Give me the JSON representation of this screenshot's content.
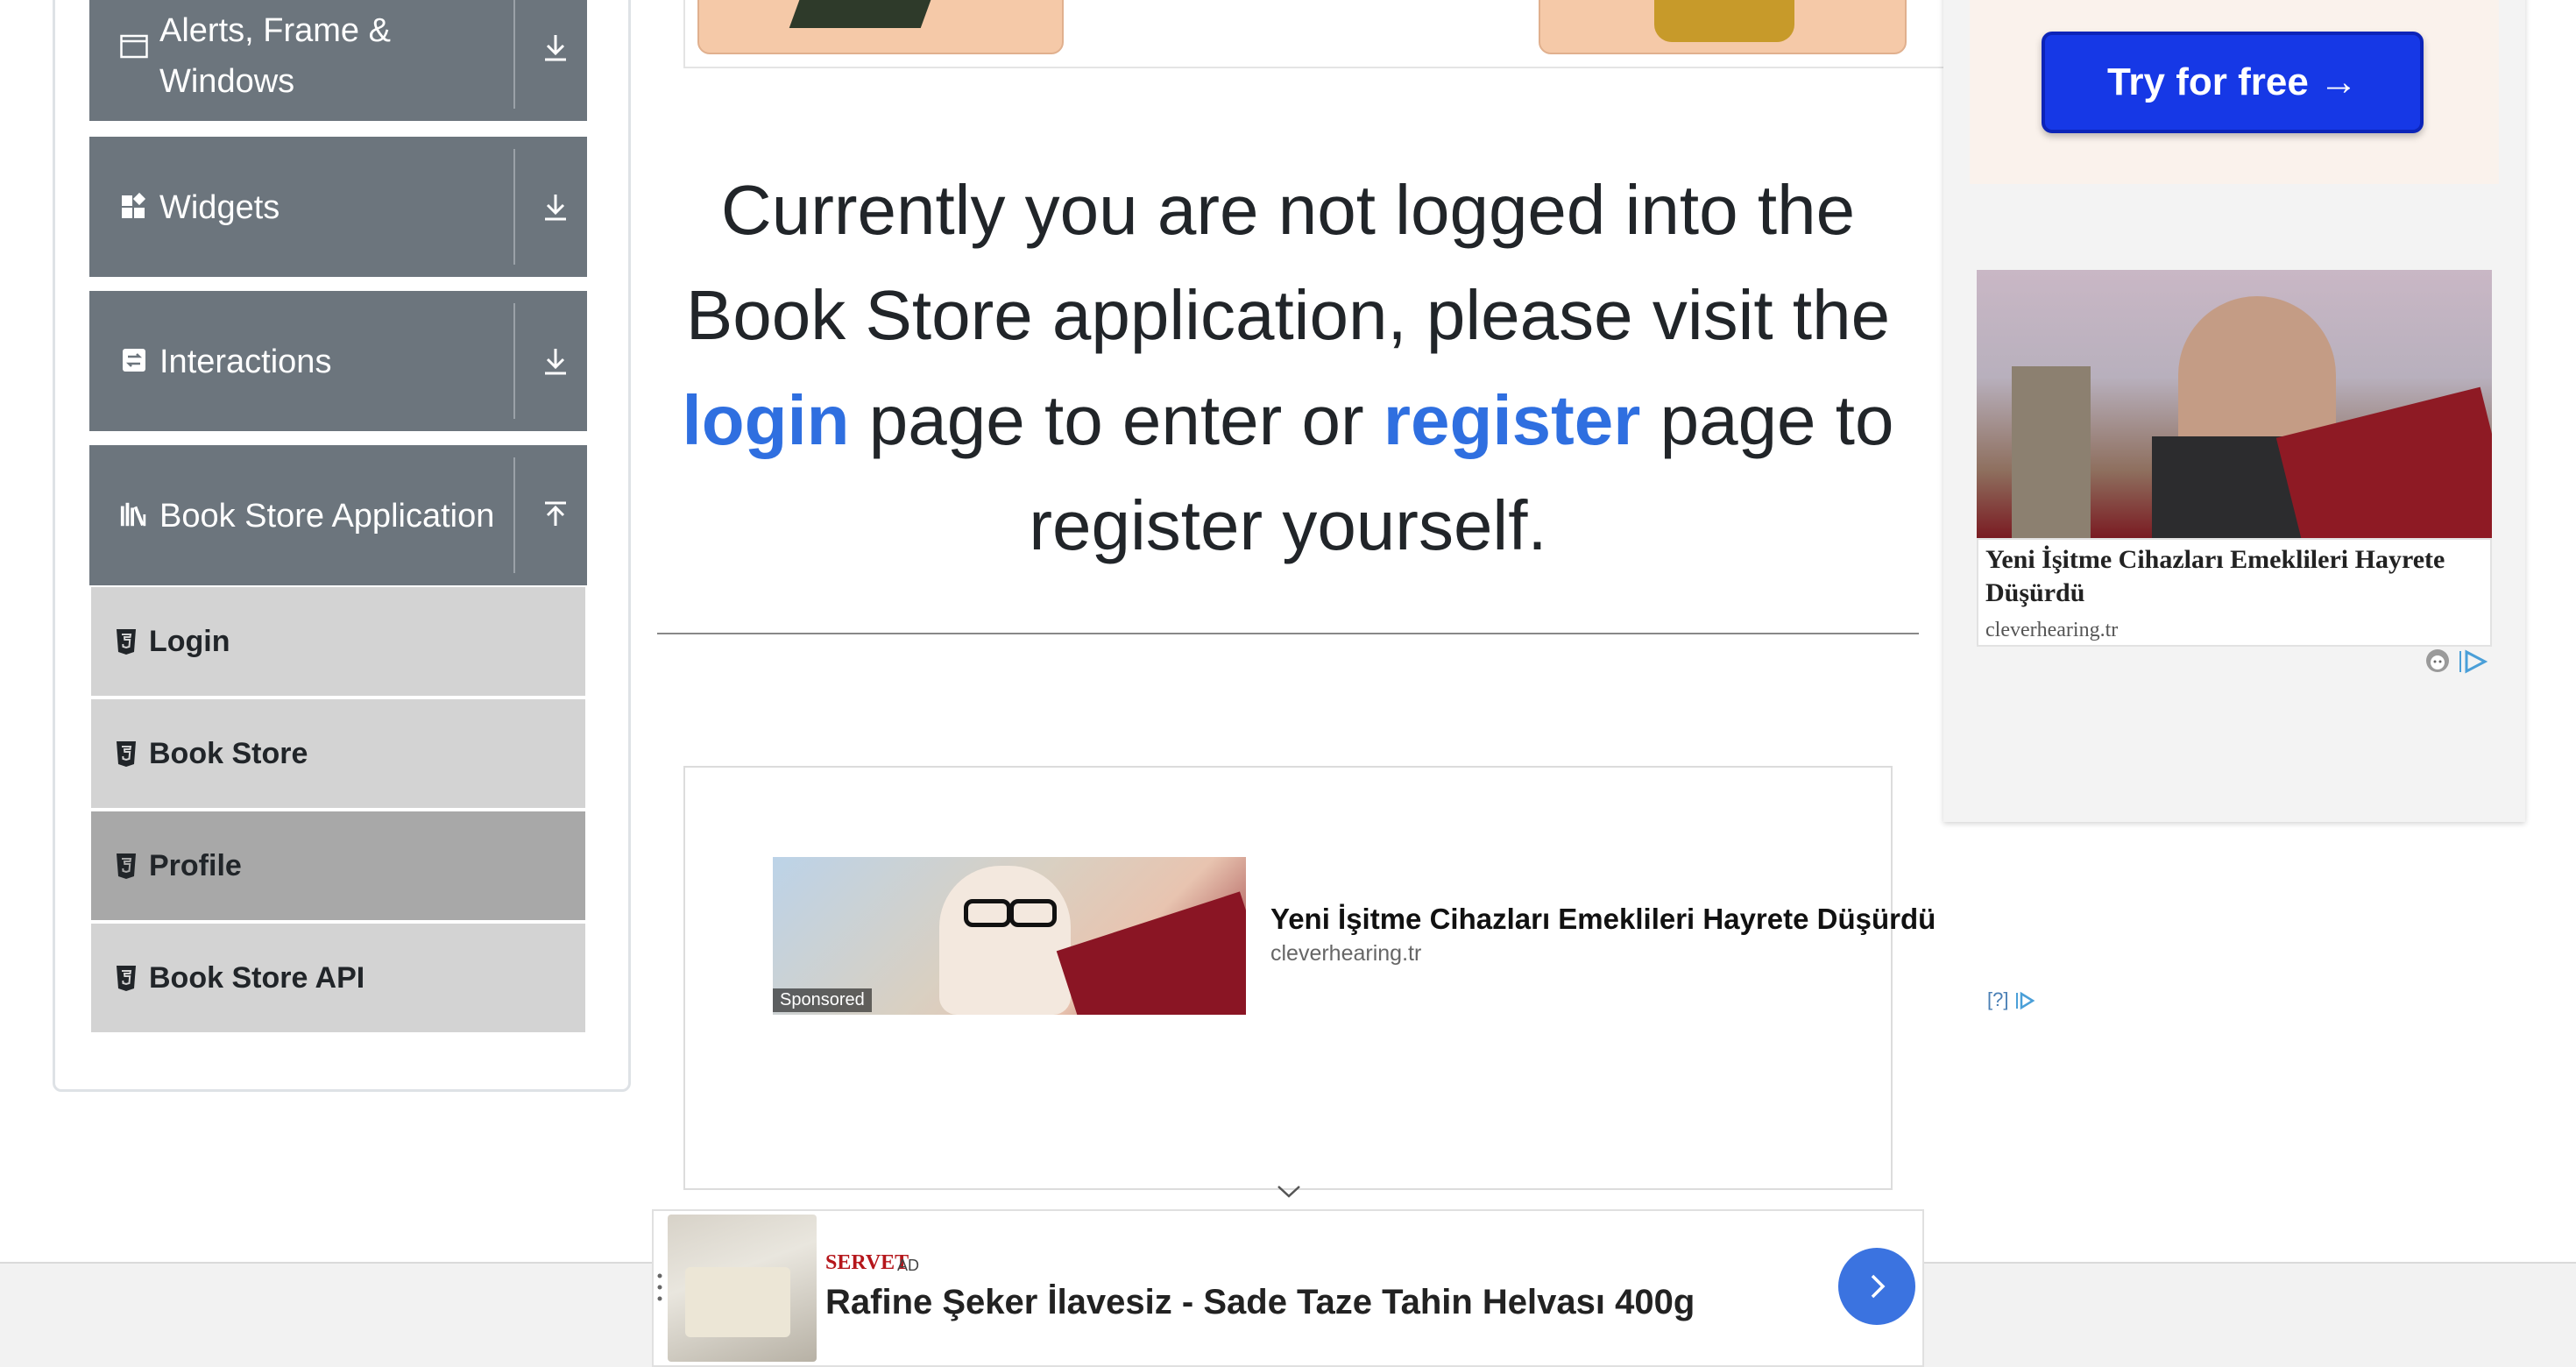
{
  "sidebar": {
    "groups": [
      {
        "label_line1": "Alerts, Frame &",
        "label_line2": "Windows",
        "icon": "window-icon",
        "chevron": "download-arrow-icon"
      },
      {
        "label": "Widgets",
        "icon": "widgets-icon",
        "chevron": "download-arrow-icon"
      },
      {
        "label": "Interactions",
        "icon": "interactions-icon",
        "chevron": "download-arrow-icon"
      },
      {
        "label": "Book Store Application",
        "icon": "books-icon",
        "chevron": "upload-arrow-icon"
      }
    ],
    "items": [
      {
        "label": "Login",
        "icon": "html5-icon",
        "active": false
      },
      {
        "label": "Book Store",
        "icon": "html5-icon",
        "active": false
      },
      {
        "label": "Profile",
        "icon": "html5-icon",
        "active": true
      },
      {
        "label": "Book Store API",
        "icon": "html5-icon",
        "active": false
      }
    ]
  },
  "main": {
    "message_part1": "Currently you are not logged into the Book Store application, please visit the",
    "login_link": "login",
    "message_part2": "page to enter or",
    "register_link": "register",
    "message_part3": "page to register yourself."
  },
  "ads": {
    "inline": {
      "title": "Yeni İşitme Cihazları Emeklileri Hayrete Düşürdü",
      "domain": "cleverhearing.tr",
      "sponsored": "Sponsored",
      "choices": "[?]"
    },
    "right": {
      "button": "Try for free →",
      "title": "Yeni İşitme Cihazları Emeklileri Hayrete Düşürdü",
      "domain": "cleverhearing.tr"
    },
    "bottom": {
      "brand": "SERVET",
      "ad_label": "AD",
      "title": "Rafine Şeker İlavesiz - Sade Taze Tahin Helvası 400g"
    }
  },
  "colors": {
    "sidebar_group": "#6c757d",
    "sidebar_item": "#d3d3d3",
    "sidebar_item_active": "#a8a8a8",
    "link": "#2f6fe0",
    "cta_blue": "#1638e6"
  }
}
